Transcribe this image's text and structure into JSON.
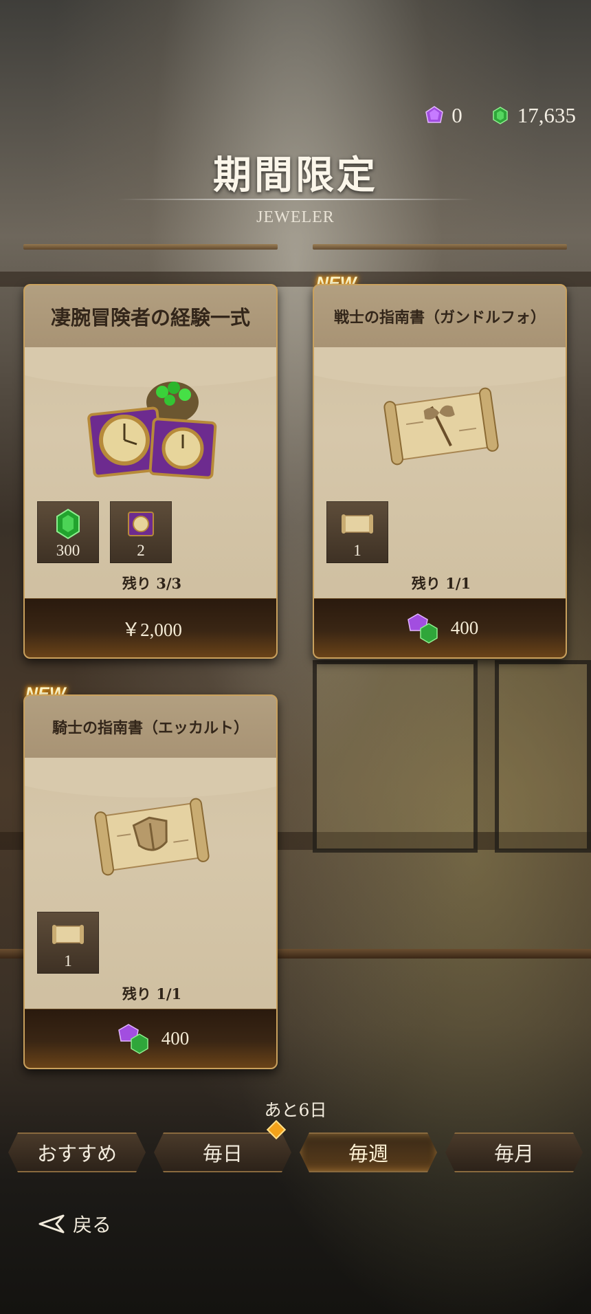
{
  "header": {
    "premium_gem_count": "0",
    "green_gem_count": "17,635",
    "title": "期間限定",
    "subtitle": "JEWELER"
  },
  "products": [
    {
      "name": "凄腕冒険者の経験一式",
      "is_new": false,
      "art": "pocket-watch-books-and-gem-sack",
      "contents": [
        {
          "icon": "green-gem-icon",
          "count": "300"
        },
        {
          "icon": "watch-book-icon",
          "count": "2"
        }
      ],
      "remaining": "残り 3/3",
      "price": "￥2,000",
      "price_icon": null
    },
    {
      "name": "戦士の指南書（ガンドルフォ）",
      "is_new": true,
      "new_label": "NEW",
      "art": "scroll-axe",
      "contents": [
        {
          "icon": "scroll-icon",
          "count": "1"
        }
      ],
      "remaining": "残り 1/1",
      "price": "400",
      "price_icon": "gem-pair-icon"
    },
    {
      "name": "騎士の指南書（エッカルト）",
      "is_new": true,
      "new_label": "NEW",
      "art": "scroll-shield",
      "contents": [
        {
          "icon": "scroll-icon",
          "count": "1"
        }
      ],
      "remaining": "残り 1/1",
      "price": "400",
      "price_icon": "gem-pair-icon"
    }
  ],
  "footer": {
    "days_left": "あと6日",
    "tabs": [
      {
        "label": "おすすめ",
        "active": false,
        "notification": false
      },
      {
        "label": "毎日",
        "active": false,
        "notification": true
      },
      {
        "label": "毎週",
        "active": true,
        "notification": false
      },
      {
        "label": "毎月",
        "active": false,
        "notification": false
      }
    ],
    "back_label": "戻る"
  },
  "colors": {
    "card_border": "#caa15d",
    "card_body": "#d6c7aa",
    "price_bar": "#3a2614",
    "new_glow": "#ffb01a",
    "premium_gem": "#a24ee0",
    "green_gem": "#2fa63a"
  }
}
